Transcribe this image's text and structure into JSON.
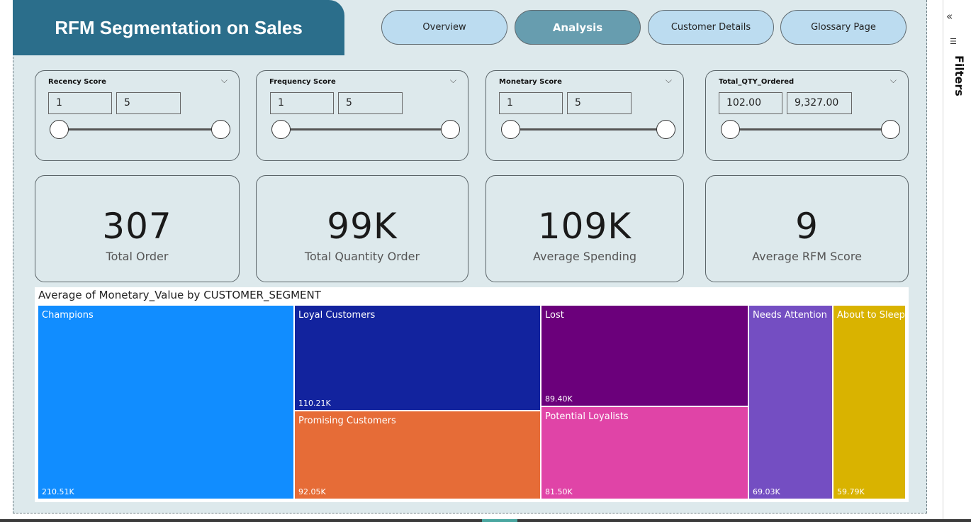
{
  "header": {
    "title": "RFM Segmentation on Sales"
  },
  "nav": [
    {
      "label": "Overview",
      "active": false
    },
    {
      "label": "Analysis",
      "active": true
    },
    {
      "label": "Customer Details",
      "active": false
    },
    {
      "label": "Glossary Page",
      "active": false
    }
  ],
  "slicers": [
    {
      "title": "Recency Score",
      "min": "1",
      "max": "5"
    },
    {
      "title": "Frequency Score",
      "min": "1",
      "max": "5"
    },
    {
      "title": "Monetary Score",
      "min": "1",
      "max": "5"
    },
    {
      "title": "Total_QTY_Ordered",
      "min": "102.00",
      "max": "9,327.00"
    }
  ],
  "kpis": [
    {
      "value": "307",
      "label": "Total Order"
    },
    {
      "value": "99K",
      "label": "Total Quantity Order"
    },
    {
      "value": "109K",
      "label": "Average Spending"
    },
    {
      "value": "9",
      "label": "Average RFM Score"
    }
  ],
  "treemap": {
    "title": "Average of Monetary_Value by CUSTOMER_SEGMENT",
    "segments": [
      {
        "name": "Champions",
        "value": "210.51K",
        "color": "#118dff"
      },
      {
        "name": "Loyal Customers",
        "value": "110.21K",
        "color": "#12239e"
      },
      {
        "name": "Promising Customers",
        "value": "92.05K",
        "color": "#e66c37"
      },
      {
        "name": "Lost",
        "value": "89.40K",
        "color": "#6b007b"
      },
      {
        "name": "Potential Loyalists",
        "value": "81.50K",
        "color": "#e044a7"
      },
      {
        "name": "Needs Attention",
        "value": "69.03K",
        "color": "#744ec2"
      },
      {
        "name": "About to Sleep",
        "value": "59.79K",
        "color": "#d9b300"
      }
    ]
  },
  "chart_data": {
    "type": "treemap",
    "title": "Average of Monetary_Value by CUSTOMER_SEGMENT",
    "categories": [
      "Champions",
      "Loyal Customers",
      "Promising Customers",
      "Lost",
      "Potential Loyalists",
      "Needs Attention",
      "About to Sleep"
    ],
    "values": [
      210510,
      110210,
      92050,
      89400,
      81500,
      69030,
      59790
    ]
  },
  "filters_pane": {
    "label": "Filters",
    "collapse_icon": "double-chevron-left-icon",
    "filter_icon": "filter-icon"
  }
}
